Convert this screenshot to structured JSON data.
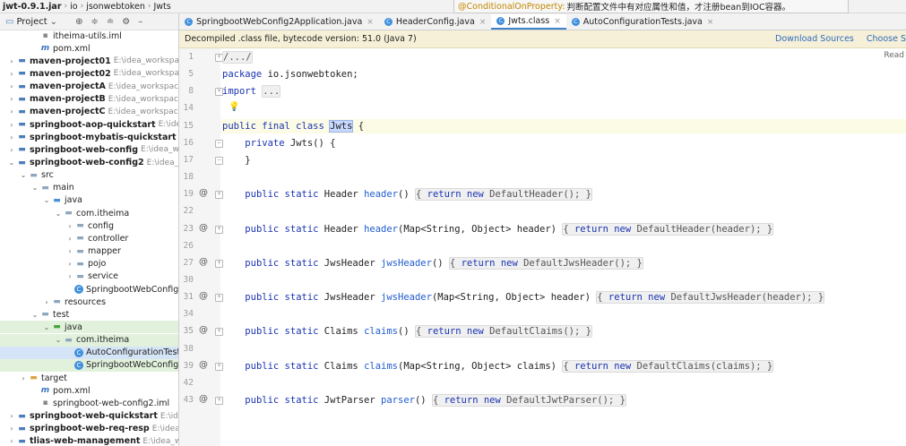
{
  "breadcrumb": {
    "items": [
      "jwt-0.9.1.jar",
      "io",
      "jsonwebtoken",
      "Jwts"
    ]
  },
  "hint": {
    "key": "@ConditionalOnProperty:",
    "text": " 判断配置文件中有对应属性和值，才注册bean到IOC容器。"
  },
  "project": {
    "title": "Project",
    "tree": [
      {
        "depth": 2,
        "arrow": "",
        "icon": "file-iml",
        "glyph": "▪",
        "label": "itheima-utils.iml",
        "path": "",
        "bold": false,
        "state": ""
      },
      {
        "depth": 2,
        "arrow": "",
        "icon": "file-xml",
        "glyph": "m",
        "label": "pom.xml",
        "path": "",
        "bold": false,
        "state": ""
      },
      {
        "depth": 0,
        "arrow": "›",
        "icon": "module",
        "glyph": "▬",
        "label": "maven-project01",
        "path": "E:\\idea_workspace\\ith",
        "bold": true,
        "state": ""
      },
      {
        "depth": 0,
        "arrow": "›",
        "icon": "module",
        "glyph": "▬",
        "label": "maven-project02",
        "path": "E:\\idea_workspace\\ith",
        "bold": true,
        "state": ""
      },
      {
        "depth": 0,
        "arrow": "›",
        "icon": "module",
        "glyph": "▬",
        "label": "maven-projectA",
        "path": "E:\\idea_workspace\\ith",
        "bold": true,
        "state": ""
      },
      {
        "depth": 0,
        "arrow": "›",
        "icon": "module",
        "glyph": "▬",
        "label": "maven-projectB",
        "path": "E:\\idea_workspace\\ith",
        "bold": true,
        "state": ""
      },
      {
        "depth": 0,
        "arrow": "›",
        "icon": "module",
        "glyph": "▬",
        "label": "maven-projectC",
        "path": "E:\\idea_workspace\\ith",
        "bold": true,
        "state": ""
      },
      {
        "depth": 0,
        "arrow": "›",
        "icon": "module",
        "glyph": "▬",
        "label": "springboot-aop-quickstart",
        "path": "E:\\idea_wor",
        "bold": true,
        "state": ""
      },
      {
        "depth": 0,
        "arrow": "›",
        "icon": "module",
        "glyph": "▬",
        "label": "springboot-mybatis-quickstart",
        "path": "E:\\ide",
        "bold": true,
        "state": ""
      },
      {
        "depth": 0,
        "arrow": "›",
        "icon": "module",
        "glyph": "▬",
        "label": "springboot-web-config",
        "path": "E:\\idea_works",
        "bold": true,
        "state": ""
      },
      {
        "depth": 0,
        "arrow": "⌄",
        "icon": "module",
        "glyph": "▬",
        "label": "springboot-web-config2",
        "path": "E:\\idea_work",
        "bold": true,
        "state": ""
      },
      {
        "depth": 1,
        "arrow": "⌄",
        "icon": "folder",
        "glyph": "▬",
        "label": "src",
        "path": "",
        "bold": false,
        "state": ""
      },
      {
        "depth": 2,
        "arrow": "⌄",
        "icon": "folder",
        "glyph": "▬",
        "label": "main",
        "path": "",
        "bold": false,
        "state": ""
      },
      {
        "depth": 3,
        "arrow": "⌄",
        "icon": "src",
        "glyph": "▬",
        "label": "java",
        "path": "",
        "bold": false,
        "state": ""
      },
      {
        "depth": 4,
        "arrow": "⌄",
        "icon": "folder",
        "glyph": "▬",
        "label": "com.itheima",
        "path": "",
        "bold": false,
        "state": ""
      },
      {
        "depth": 5,
        "arrow": "›",
        "icon": "folder",
        "glyph": "▬",
        "label": "config",
        "path": "",
        "bold": false,
        "state": ""
      },
      {
        "depth": 5,
        "arrow": "›",
        "icon": "folder",
        "glyph": "▬",
        "label": "controller",
        "path": "",
        "bold": false,
        "state": ""
      },
      {
        "depth": 5,
        "arrow": "›",
        "icon": "folder",
        "glyph": "▬",
        "label": "mapper",
        "path": "",
        "bold": false,
        "state": ""
      },
      {
        "depth": 5,
        "arrow": "›",
        "icon": "folder",
        "glyph": "▬",
        "label": "pojo",
        "path": "",
        "bold": false,
        "state": ""
      },
      {
        "depth": 5,
        "arrow": "›",
        "icon": "folder",
        "glyph": "▬",
        "label": "service",
        "path": "",
        "bold": false,
        "state": ""
      },
      {
        "depth": 5,
        "arrow": "",
        "icon": "class",
        "glyph": "C",
        "label": "SpringbootWebConfig2",
        "path": "",
        "bold": false,
        "state": ""
      },
      {
        "depth": 3,
        "arrow": "›",
        "icon": "folder",
        "glyph": "▬",
        "label": "resources",
        "path": "",
        "bold": false,
        "state": ""
      },
      {
        "depth": 2,
        "arrow": "⌄",
        "icon": "folder",
        "glyph": "▬",
        "label": "test",
        "path": "",
        "bold": false,
        "state": ""
      },
      {
        "depth": 3,
        "arrow": "⌄",
        "icon": "test",
        "glyph": "▬",
        "label": "java",
        "path": "",
        "bold": false,
        "state": "green"
      },
      {
        "depth": 4,
        "arrow": "⌄",
        "icon": "folder",
        "glyph": "▬",
        "label": "com.itheima",
        "path": "",
        "bold": false,
        "state": "green"
      },
      {
        "depth": 5,
        "arrow": "",
        "icon": "class",
        "glyph": "C",
        "label": "AutoConfigurationTests",
        "path": "",
        "bold": false,
        "state": "selected"
      },
      {
        "depth": 5,
        "arrow": "",
        "icon": "class",
        "glyph": "C",
        "label": "SpringbootWebConfig2A",
        "path": "",
        "bold": false,
        "state": "green"
      },
      {
        "depth": 1,
        "arrow": "›",
        "icon": "target",
        "glyph": "▬",
        "label": "target",
        "path": "",
        "bold": false,
        "state": ""
      },
      {
        "depth": 2,
        "arrow": "",
        "icon": "file-xml",
        "glyph": "m",
        "label": "pom.xml",
        "path": "",
        "bold": false,
        "state": ""
      },
      {
        "depth": 2,
        "arrow": "",
        "icon": "file-iml",
        "glyph": "▪",
        "label": "springboot-web-config2.iml",
        "path": "",
        "bold": false,
        "state": ""
      },
      {
        "depth": 0,
        "arrow": "›",
        "icon": "module",
        "glyph": "▬",
        "label": "springboot-web-quickstart",
        "path": "E:\\idea_wo",
        "bold": true,
        "state": ""
      },
      {
        "depth": 0,
        "arrow": "›",
        "icon": "module",
        "glyph": "▬",
        "label": "springboot-web-req-resp",
        "path": "E:\\idea_wor",
        "bold": true,
        "state": ""
      },
      {
        "depth": 0,
        "arrow": "›",
        "icon": "module",
        "glyph": "▬",
        "label": "tlias-web-management",
        "path": "E:\\idea_works",
        "bold": true,
        "state": ""
      }
    ]
  },
  "tabs": [
    {
      "label": "SpringbootWebConfig2Application.java",
      "active": false
    },
    {
      "label": "HeaderConfig.java",
      "active": false
    },
    {
      "label": "Jwts.class",
      "active": true
    },
    {
      "label": "AutoConfigurationTests.java",
      "active": false
    }
  ],
  "notice": {
    "text": "Decompiled .class file, bytecode version: 51.0 (Java 7)",
    "download_sources": "Download Sources",
    "choose_sources": "Choose S"
  },
  "editor": {
    "read_mode": "Read",
    "lines": [
      {
        "num": "1",
        "at": false,
        "fold": "+",
        "bulb": false,
        "current": false,
        "html": "<span class=\"fold-box\">/.../</span>"
      },
      {
        "num": "5",
        "at": false,
        "fold": "",
        "bulb": false,
        "current": false,
        "html": "<span class=\"kw\">package</span> io.jsonwebtoken;"
      },
      {
        "num": "8",
        "at": false,
        "fold": "+",
        "bulb": false,
        "current": false,
        "html": "<span class=\"kw\">import</span> <span class=\"fold-box\">...</span>"
      },
      {
        "num": "14",
        "at": false,
        "fold": "",
        "bulb": true,
        "current": false,
        "html": ""
      },
      {
        "num": "15",
        "at": false,
        "fold": "",
        "bulb": false,
        "current": true,
        "html": "<span class=\"kw\">public final class</span> <span class=\"cls-hl\">Jwts</span> {"
      },
      {
        "num": "16",
        "at": false,
        "fold": "-",
        "bulb": false,
        "current": false,
        "html": "    <span class=\"kw\">private</span> Jwts() {"
      },
      {
        "num": "17",
        "at": false,
        "fold": "-",
        "bulb": false,
        "current": false,
        "html": "    }"
      },
      {
        "num": "18",
        "at": false,
        "fold": "",
        "bulb": false,
        "current": false,
        "html": ""
      },
      {
        "num": "19",
        "at": true,
        "fold": "+",
        "bulb": false,
        "current": false,
        "html": "    <span class=\"kw\">public static</span> Header <span class=\"fn\">header</span>() <span class=\"fold-box\">{ <span class=\"kw\">return new</span> DefaultHeader(); }</span>"
      },
      {
        "num": "22",
        "at": false,
        "fold": "",
        "bulb": false,
        "current": false,
        "html": ""
      },
      {
        "num": "23",
        "at": true,
        "fold": "+",
        "bulb": false,
        "current": false,
        "html": "    <span class=\"kw\">public static</span> Header <span class=\"fn\">header</span>(Map&lt;String, Object&gt; header) <span class=\"fold-box\">{ <span class=\"kw\">return new</span> DefaultHeader(header); }</span>"
      },
      {
        "num": "26",
        "at": false,
        "fold": "",
        "bulb": false,
        "current": false,
        "html": ""
      },
      {
        "num": "27",
        "at": true,
        "fold": "+",
        "bulb": false,
        "current": false,
        "html": "    <span class=\"kw\">public static</span> JwsHeader <span class=\"fn\">jwsHeader</span>() <span class=\"fold-box\">{ <span class=\"kw\">return new</span> DefaultJwsHeader(); }</span>"
      },
      {
        "num": "30",
        "at": false,
        "fold": "",
        "bulb": false,
        "current": false,
        "html": ""
      },
      {
        "num": "31",
        "at": true,
        "fold": "+",
        "bulb": false,
        "current": false,
        "html": "    <span class=\"kw\">public static</span> JwsHeader <span class=\"fn\">jwsHeader</span>(Map&lt;String, Object&gt; header) <span class=\"fold-box\">{ <span class=\"kw\">return new</span> DefaultJwsHeader(header); }</span>"
      },
      {
        "num": "34",
        "at": false,
        "fold": "",
        "bulb": false,
        "current": false,
        "html": ""
      },
      {
        "num": "35",
        "at": true,
        "fold": "+",
        "bulb": false,
        "current": false,
        "html": "    <span class=\"kw\">public static</span> Claims <span class=\"fn\">claims</span>() <span class=\"fold-box\">{ <span class=\"kw\">return new</span> DefaultClaims(); }</span>"
      },
      {
        "num": "38",
        "at": false,
        "fold": "",
        "bulb": false,
        "current": false,
        "html": ""
      },
      {
        "num": "39",
        "at": true,
        "fold": "+",
        "bulb": false,
        "current": false,
        "html": "    <span class=\"kw\">public static</span> Claims <span class=\"fn\">claims</span>(Map&lt;String, Object&gt; claims) <span class=\"fold-box\">{ <span class=\"kw\">return new</span> DefaultClaims(claims); }</span>"
      },
      {
        "num": "42",
        "at": false,
        "fold": "",
        "bulb": false,
        "current": false,
        "html": ""
      },
      {
        "num": "43",
        "at": true,
        "fold": "+",
        "bulb": false,
        "current": false,
        "html": "    <span class=\"kw\">public static</span> JwtParser <span class=\"fn\">parser</span>() <span class=\"fold-box\">{ <span class=\"kw\">return new</span> DefaultJwtParser(); }</span>"
      }
    ]
  },
  "colors": {
    "keyword": "#1a33b0",
    "method": "#1f5bd0",
    "tab_active_underline": "#4083c9",
    "selection": "#d5e4f7",
    "test_tint": "#e2f1dc",
    "notice_bg": "#f5f0d7"
  },
  "icons": {
    "project_dropdown": "chevron-down-icon",
    "globe": "globe-icon",
    "collapse": "collapse-all-icon",
    "expand": "expand-all-icon",
    "settings": "gear-icon",
    "hide": "minus-icon"
  }
}
